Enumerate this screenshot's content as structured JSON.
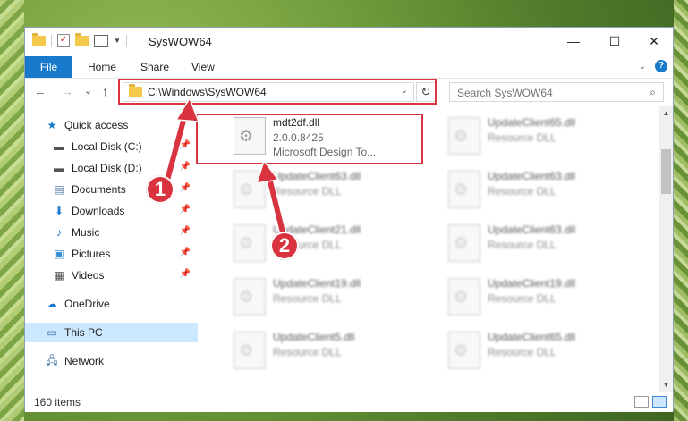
{
  "window": {
    "title": "SysWOW64",
    "minimize": "—",
    "maximize": "☐",
    "close": "✕"
  },
  "ribbon": {
    "tabs": [
      "File",
      "Home",
      "Share",
      "View"
    ]
  },
  "navigation": {
    "back": "←",
    "forward": "→",
    "recent": "⌄",
    "up": "↑",
    "address": "C:\\Windows\\SysWOW64",
    "refresh": "↻",
    "search_placeholder": "Search SysWOW64"
  },
  "sidebar": {
    "items": [
      {
        "label": "Quick access",
        "icon": "star-icon"
      },
      {
        "label": "Local Disk (C:)",
        "icon": "drive-icon"
      },
      {
        "label": "Local Disk (D:)",
        "icon": "drive-icon"
      },
      {
        "label": "Documents",
        "icon": "documents-icon"
      },
      {
        "label": "Downloads",
        "icon": "download-icon"
      },
      {
        "label": "Music",
        "icon": "music-icon"
      },
      {
        "label": "Pictures",
        "icon": "pictures-icon"
      },
      {
        "label": "Videos",
        "icon": "videos-icon"
      },
      {
        "label": "OneDrive",
        "icon": "cloud-icon"
      },
      {
        "label": "This PC",
        "icon": "computer-icon"
      },
      {
        "label": "Network",
        "icon": "network-icon"
      }
    ]
  },
  "files": [
    {
      "name": "mdt2df.dll",
      "line2": "2.0.0.8425",
      "line3": "Microsoft Design To..."
    },
    {
      "name": "UpdateClient65.dll",
      "line2": "Resource DLL"
    },
    {
      "name": "UpdateClient63.dll",
      "line2": "Resource DLL"
    },
    {
      "name": "UpdateClient63.dll",
      "line2": "Resource DLL"
    },
    {
      "name": "UpdateClient21.dll",
      "line2": "Resource DLL"
    },
    {
      "name": "UpdateClient63.dll",
      "line2": "Resource DLL"
    },
    {
      "name": "UpdateClient19.dll",
      "line2": "Resource DLL"
    },
    {
      "name": "UpdateClient19.dll",
      "line2": "Resource DLL"
    },
    {
      "name": "UpdateClient5.dll",
      "line2": "Resource DLL"
    },
    {
      "name": "UpdateClient65.dll",
      "line2": "Resource DLL"
    }
  ],
  "status": {
    "count": "160 items"
  },
  "callouts": {
    "one": "1",
    "two": "2"
  },
  "colors": {
    "accent": "#1979ca",
    "highlight": "#d9333f",
    "selected": "#cce8ff"
  }
}
